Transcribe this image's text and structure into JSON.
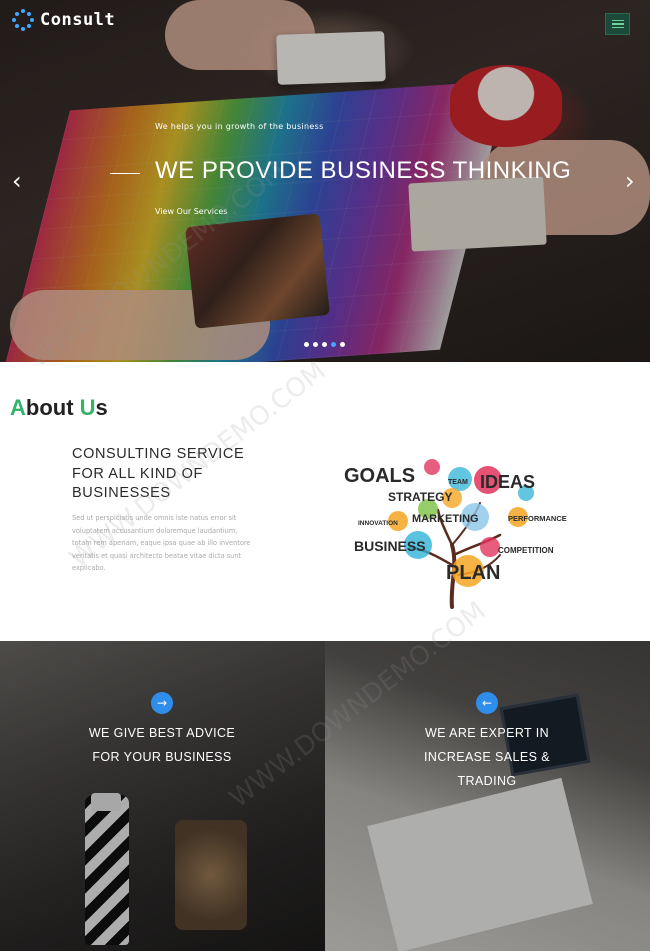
{
  "brand": {
    "name": "Consult"
  },
  "icons": {
    "logo": "dot-ring-icon",
    "menu": "hamburger-icon",
    "prev": "chevron-left-icon",
    "next": "chevron-right-icon",
    "feature_left": "arrow-right-icon",
    "feature_right": "arrow-left-icon"
  },
  "colors": {
    "accent_green": "#35b36b",
    "accent_blue": "#2f8dec",
    "logo_blue": "#3fa7ff"
  },
  "hero": {
    "kicker": "We helps you in growth of the business",
    "title": "WE PROVIDE BUSINESS THINKING",
    "link": "View Our Services",
    "prev_glyph": "‹",
    "next_glyph": "›"
  },
  "about": {
    "heading_a": "A",
    "heading_rest1": "bout ",
    "heading_u": "U",
    "heading_rest2": "s",
    "subheading": "CONSULTING SERVICE FOR ALL KIND OF BUSINESSES",
    "body": "Sed ut perspiciatis unde omnis iste natus error sit voluptatem accusantium doloremque laudantium, totam rem aperiam, eaque ipsa quae ab illo inventore veritatis et quasi architecto beatae vitae dicta sunt explicabo."
  },
  "tree_words": {
    "goals": "GOALS",
    "team": "TEAM",
    "ideas": "IDEAS",
    "strategy": "STRATEGY",
    "innovation": "INNOVATION",
    "marketing": "MARKETING",
    "performance": "PERFORMANCE",
    "business": "BUSINESS",
    "competition": "COMPETITION",
    "plan": "PLAN"
  },
  "features": [
    {
      "arrow": "→",
      "text": "WE GIVE BEST ADVICE FOR YOUR BUSINESS"
    },
    {
      "arrow": "←",
      "text": "WE ARE EXPERT IN INCREASE SALES & TRADING"
    }
  ],
  "watermark": "WWW.DOWNDEMO.COM"
}
